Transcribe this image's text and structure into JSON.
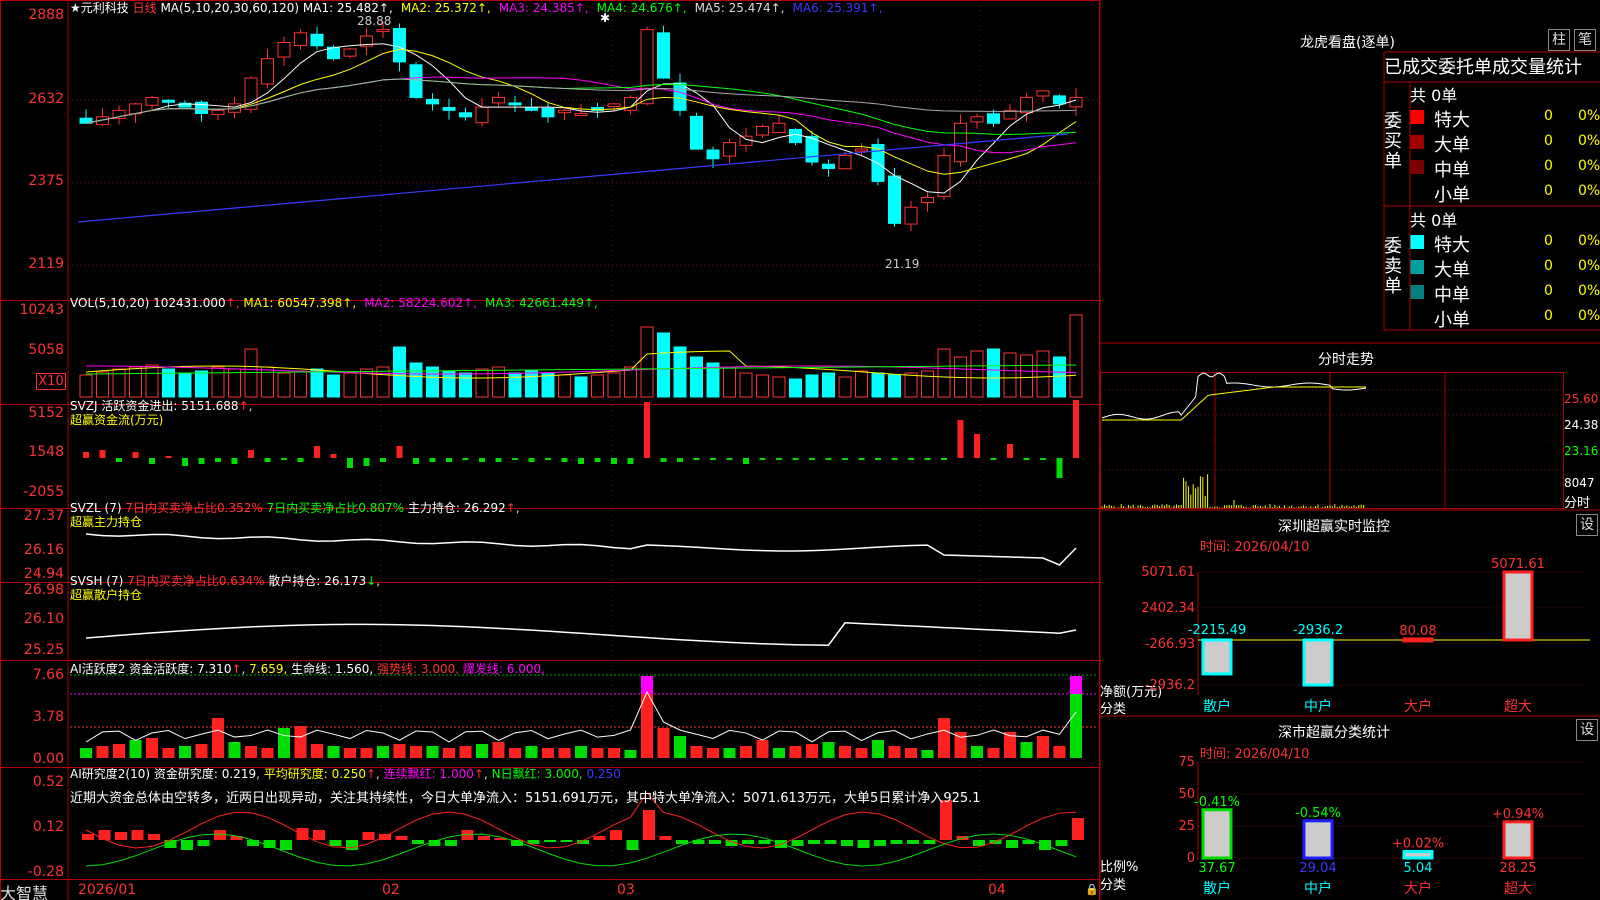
{
  "stock": {
    "name": "★元利科技",
    "period": "日线"
  },
  "ma_header": {
    "label": "MA(5,10,20,30,60,120)",
    "items": [
      {
        "name": "MA1:",
        "value": "25.482",
        "arrow": "↑",
        "color": "#ffffff"
      },
      {
        "name": "MA2:",
        "value": "25.372",
        "arrow": "↑",
        "color": "#ffff00"
      },
      {
        "name": "MA3:",
        "value": "24.385",
        "arrow": "↑",
        "color": "#ff00ff"
      },
      {
        "name": "MA4:",
        "value": "24.676",
        "arrow": "↑",
        "color": "#00ff00"
      },
      {
        "name": "MA5:",
        "value": "25.474",
        "arrow": "↑",
        "color": "#dddddd"
      },
      {
        "name": "MA6:",
        "value": "25.391",
        "arrow": "↑",
        "color": "#3a3aff"
      }
    ]
  },
  "main_axis": [
    "2888",
    "2632",
    "2375",
    "2119"
  ],
  "hi_mark": "28.88",
  "lo_mark": "21.19",
  "vol": {
    "label": "VOL(5,10,20)",
    "value": "102431.000",
    "ma": [
      {
        "name": "MA1:",
        "value": "60547.398",
        "color": "#ffff00"
      },
      {
        "name": "MA2:",
        "value": "58224.602",
        "color": "#ff00ff"
      },
      {
        "name": "MA3:",
        "value": "42661.449",
        "color": "#00ff00"
      }
    ],
    "axis": [
      "10243",
      "5058"
    ],
    "unit": "X10"
  },
  "svzj": {
    "label": "SVZJ",
    "desc": "活跃资金进出:",
    "value": "5151.688",
    "sub": "超赢资金流(万元)",
    "axis": [
      "5152",
      "1548",
      "-2055"
    ]
  },
  "svzl": {
    "label": "SVZL (7)",
    "t1": "7日内买卖净占比0.352%",
    "t2": "7日内买卖净占比0.807%",
    "t3": "主力持仓:",
    "value": "26.292",
    "sub": "超赢主力持仓",
    "axis": [
      "27.37",
      "26.16",
      "24.94"
    ]
  },
  "svsh": {
    "label": "SVSH (7)",
    "t1": "7日内买卖净占比0.634%",
    "t3": "散户持仓:",
    "value": "26.173",
    "sub": "超赢散户持仓",
    "axis": [
      "26.98",
      "26.10",
      "25.25"
    ]
  },
  "ai1": {
    "label": "AI活跃度2",
    "t1": "资金活跃度:",
    "v1": "7.310",
    "v2": "7.659,",
    "t3": "生命线:",
    "v3": "1.560,",
    "t4": "强势线:",
    "v4": "3.000,",
    "t5": "爆发线:",
    "v5": "6.000,",
    "axis": [
      "7.66",
      "3.78",
      "0.00"
    ]
  },
  "ai2": {
    "label": "AI研究度2(10)",
    "t1": "资金研究度:",
    "v1": "0.219",
    "t2": "平均研究度:",
    "v2": "0.250",
    "t3": "连续飘红:",
    "v3": "1.000",
    "t4": "N日飘红:",
    "v4": "3.000,",
    "v5": "0.250",
    "axis": [
      "0.52",
      "0.12",
      "-0.28"
    ],
    "comment": "近期大资金总体由空转多，近两日出现异动，关注其持续性，今日大单净流入：5151.691万元，其中特大单净流入：5071.613万元，大单5日累计净入925.1"
  },
  "date_axis": [
    "2026/01",
    "02",
    "03",
    "04"
  ],
  "brand": "大智慧",
  "right": {
    "title": "龙虎看盘(逐单)",
    "btn1": "柱",
    "btn2": "笔",
    "tabs": [
      "已成交",
      "委托单",
      "成交量统计"
    ],
    "buy": {
      "side": "委买单",
      "count": "共 0单",
      "rows": [
        {
          "label": "特大",
          "qty": "0",
          "pct": "0%",
          "color": "#ff0000"
        },
        {
          "label": "大单",
          "qty": "0",
          "pct": "0%",
          "color": "#a00000"
        },
        {
          "label": "中单",
          "qty": "0",
          "pct": "0%",
          "color": "#7a0000"
        },
        {
          "label": "小单",
          "qty": "0",
          "pct": "0%",
          "color": "#000000"
        }
      ]
    },
    "sell": {
      "side": "委卖单",
      "count": "共 0单",
      "rows": [
        {
          "label": "特大",
          "qty": "0",
          "pct": "0%",
          "color": "#00ffff"
        },
        {
          "label": "大单",
          "qty": "0",
          "pct": "0%",
          "color": "#00a0a0"
        },
        {
          "label": "中单",
          "qty": "0",
          "pct": "0%",
          "color": "#008080"
        },
        {
          "label": "小单",
          "qty": "0",
          "pct": "0%",
          "color": "#000000"
        }
      ]
    },
    "intraday": {
      "title": "分时走势",
      "axis": [
        "25.60",
        "24.38",
        "23.16",
        "8047"
      ],
      "unit": "分时"
    },
    "monitor": {
      "title": "深圳超赢实时监控",
      "btn": "设",
      "time": "时间: 2026/04/10",
      "axis": [
        "5071.61",
        "2402.34",
        "-266.93",
        "-2936.2"
      ],
      "ylabel": "净额(万元)",
      "xlabel": "分类",
      "chart_data": {
        "type": "bar",
        "categories": [
          "散户",
          "中户",
          "大户",
          "超大"
        ],
        "values": [
          -2215.49,
          -2936.2,
          80.08,
          5071.61
        ],
        "labels": [
          "-2215.49",
          "-2936.2",
          "80.08",
          "5071.61"
        ]
      }
    },
    "classify": {
      "title": "深市超赢分类统计",
      "btn": "设",
      "time": "时间: 2026/04/10",
      "axis": [
        "75",
        "50",
        "25",
        "0"
      ],
      "ylabel": "比例%",
      "xlabel": "分类",
      "chart_data": {
        "type": "bar",
        "categories": [
          "散户",
          "中户",
          "大户",
          "超大"
        ],
        "values": [
          37.67,
          29.04,
          5.04,
          28.25
        ],
        "changes": [
          "-0.41%",
          "-0.54%",
          "+0.02%",
          "+0.94%"
        ]
      }
    }
  }
}
